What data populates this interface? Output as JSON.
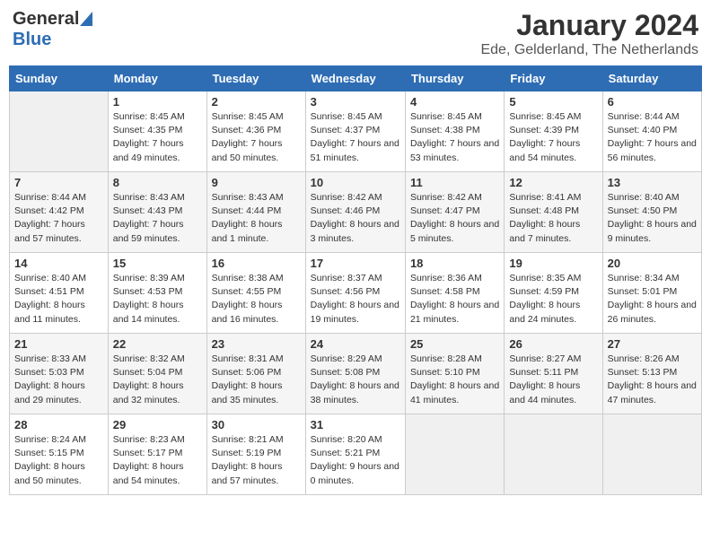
{
  "header": {
    "logo_general": "General",
    "logo_blue": "Blue",
    "month_title": "January 2024",
    "location": "Ede, Gelderland, The Netherlands"
  },
  "weekdays": [
    "Sunday",
    "Monday",
    "Tuesday",
    "Wednesday",
    "Thursday",
    "Friday",
    "Saturday"
  ],
  "weeks": [
    [
      {
        "day": "",
        "sunrise": "",
        "sunset": "",
        "daylight": ""
      },
      {
        "day": "1",
        "sunrise": "Sunrise: 8:45 AM",
        "sunset": "Sunset: 4:35 PM",
        "daylight": "Daylight: 7 hours and 49 minutes."
      },
      {
        "day": "2",
        "sunrise": "Sunrise: 8:45 AM",
        "sunset": "Sunset: 4:36 PM",
        "daylight": "Daylight: 7 hours and 50 minutes."
      },
      {
        "day": "3",
        "sunrise": "Sunrise: 8:45 AM",
        "sunset": "Sunset: 4:37 PM",
        "daylight": "Daylight: 7 hours and 51 minutes."
      },
      {
        "day": "4",
        "sunrise": "Sunrise: 8:45 AM",
        "sunset": "Sunset: 4:38 PM",
        "daylight": "Daylight: 7 hours and 53 minutes."
      },
      {
        "day": "5",
        "sunrise": "Sunrise: 8:45 AM",
        "sunset": "Sunset: 4:39 PM",
        "daylight": "Daylight: 7 hours and 54 minutes."
      },
      {
        "day": "6",
        "sunrise": "Sunrise: 8:44 AM",
        "sunset": "Sunset: 4:40 PM",
        "daylight": "Daylight: 7 hours and 56 minutes."
      }
    ],
    [
      {
        "day": "7",
        "sunrise": "Sunrise: 8:44 AM",
        "sunset": "Sunset: 4:42 PM",
        "daylight": "Daylight: 7 hours and 57 minutes."
      },
      {
        "day": "8",
        "sunrise": "Sunrise: 8:43 AM",
        "sunset": "Sunset: 4:43 PM",
        "daylight": "Daylight: 7 hours and 59 minutes."
      },
      {
        "day": "9",
        "sunrise": "Sunrise: 8:43 AM",
        "sunset": "Sunset: 4:44 PM",
        "daylight": "Daylight: 8 hours and 1 minute."
      },
      {
        "day": "10",
        "sunrise": "Sunrise: 8:42 AM",
        "sunset": "Sunset: 4:46 PM",
        "daylight": "Daylight: 8 hours and 3 minutes."
      },
      {
        "day": "11",
        "sunrise": "Sunrise: 8:42 AM",
        "sunset": "Sunset: 4:47 PM",
        "daylight": "Daylight: 8 hours and 5 minutes."
      },
      {
        "day": "12",
        "sunrise": "Sunrise: 8:41 AM",
        "sunset": "Sunset: 4:48 PM",
        "daylight": "Daylight: 8 hours and 7 minutes."
      },
      {
        "day": "13",
        "sunrise": "Sunrise: 8:40 AM",
        "sunset": "Sunset: 4:50 PM",
        "daylight": "Daylight: 8 hours and 9 minutes."
      }
    ],
    [
      {
        "day": "14",
        "sunrise": "Sunrise: 8:40 AM",
        "sunset": "Sunset: 4:51 PM",
        "daylight": "Daylight: 8 hours and 11 minutes."
      },
      {
        "day": "15",
        "sunrise": "Sunrise: 8:39 AM",
        "sunset": "Sunset: 4:53 PM",
        "daylight": "Daylight: 8 hours and 14 minutes."
      },
      {
        "day": "16",
        "sunrise": "Sunrise: 8:38 AM",
        "sunset": "Sunset: 4:55 PM",
        "daylight": "Daylight: 8 hours and 16 minutes."
      },
      {
        "day": "17",
        "sunrise": "Sunrise: 8:37 AM",
        "sunset": "Sunset: 4:56 PM",
        "daylight": "Daylight: 8 hours and 19 minutes."
      },
      {
        "day": "18",
        "sunrise": "Sunrise: 8:36 AM",
        "sunset": "Sunset: 4:58 PM",
        "daylight": "Daylight: 8 hours and 21 minutes."
      },
      {
        "day": "19",
        "sunrise": "Sunrise: 8:35 AM",
        "sunset": "Sunset: 4:59 PM",
        "daylight": "Daylight: 8 hours and 24 minutes."
      },
      {
        "day": "20",
        "sunrise": "Sunrise: 8:34 AM",
        "sunset": "Sunset: 5:01 PM",
        "daylight": "Daylight: 8 hours and 26 minutes."
      }
    ],
    [
      {
        "day": "21",
        "sunrise": "Sunrise: 8:33 AM",
        "sunset": "Sunset: 5:03 PM",
        "daylight": "Daylight: 8 hours and 29 minutes."
      },
      {
        "day": "22",
        "sunrise": "Sunrise: 8:32 AM",
        "sunset": "Sunset: 5:04 PM",
        "daylight": "Daylight: 8 hours and 32 minutes."
      },
      {
        "day": "23",
        "sunrise": "Sunrise: 8:31 AM",
        "sunset": "Sunset: 5:06 PM",
        "daylight": "Daylight: 8 hours and 35 minutes."
      },
      {
        "day": "24",
        "sunrise": "Sunrise: 8:29 AM",
        "sunset": "Sunset: 5:08 PM",
        "daylight": "Daylight: 8 hours and 38 minutes."
      },
      {
        "day": "25",
        "sunrise": "Sunrise: 8:28 AM",
        "sunset": "Sunset: 5:10 PM",
        "daylight": "Daylight: 8 hours and 41 minutes."
      },
      {
        "day": "26",
        "sunrise": "Sunrise: 8:27 AM",
        "sunset": "Sunset: 5:11 PM",
        "daylight": "Daylight: 8 hours and 44 minutes."
      },
      {
        "day": "27",
        "sunrise": "Sunrise: 8:26 AM",
        "sunset": "Sunset: 5:13 PM",
        "daylight": "Daylight: 8 hours and 47 minutes."
      }
    ],
    [
      {
        "day": "28",
        "sunrise": "Sunrise: 8:24 AM",
        "sunset": "Sunset: 5:15 PM",
        "daylight": "Daylight: 8 hours and 50 minutes."
      },
      {
        "day": "29",
        "sunrise": "Sunrise: 8:23 AM",
        "sunset": "Sunset: 5:17 PM",
        "daylight": "Daylight: 8 hours and 54 minutes."
      },
      {
        "day": "30",
        "sunrise": "Sunrise: 8:21 AM",
        "sunset": "Sunset: 5:19 PM",
        "daylight": "Daylight: 8 hours and 57 minutes."
      },
      {
        "day": "31",
        "sunrise": "Sunrise: 8:20 AM",
        "sunset": "Sunset: 5:21 PM",
        "daylight": "Daylight: 9 hours and 0 minutes."
      },
      {
        "day": "",
        "sunrise": "",
        "sunset": "",
        "daylight": ""
      },
      {
        "day": "",
        "sunrise": "",
        "sunset": "",
        "daylight": ""
      },
      {
        "day": "",
        "sunrise": "",
        "sunset": "",
        "daylight": ""
      }
    ]
  ]
}
